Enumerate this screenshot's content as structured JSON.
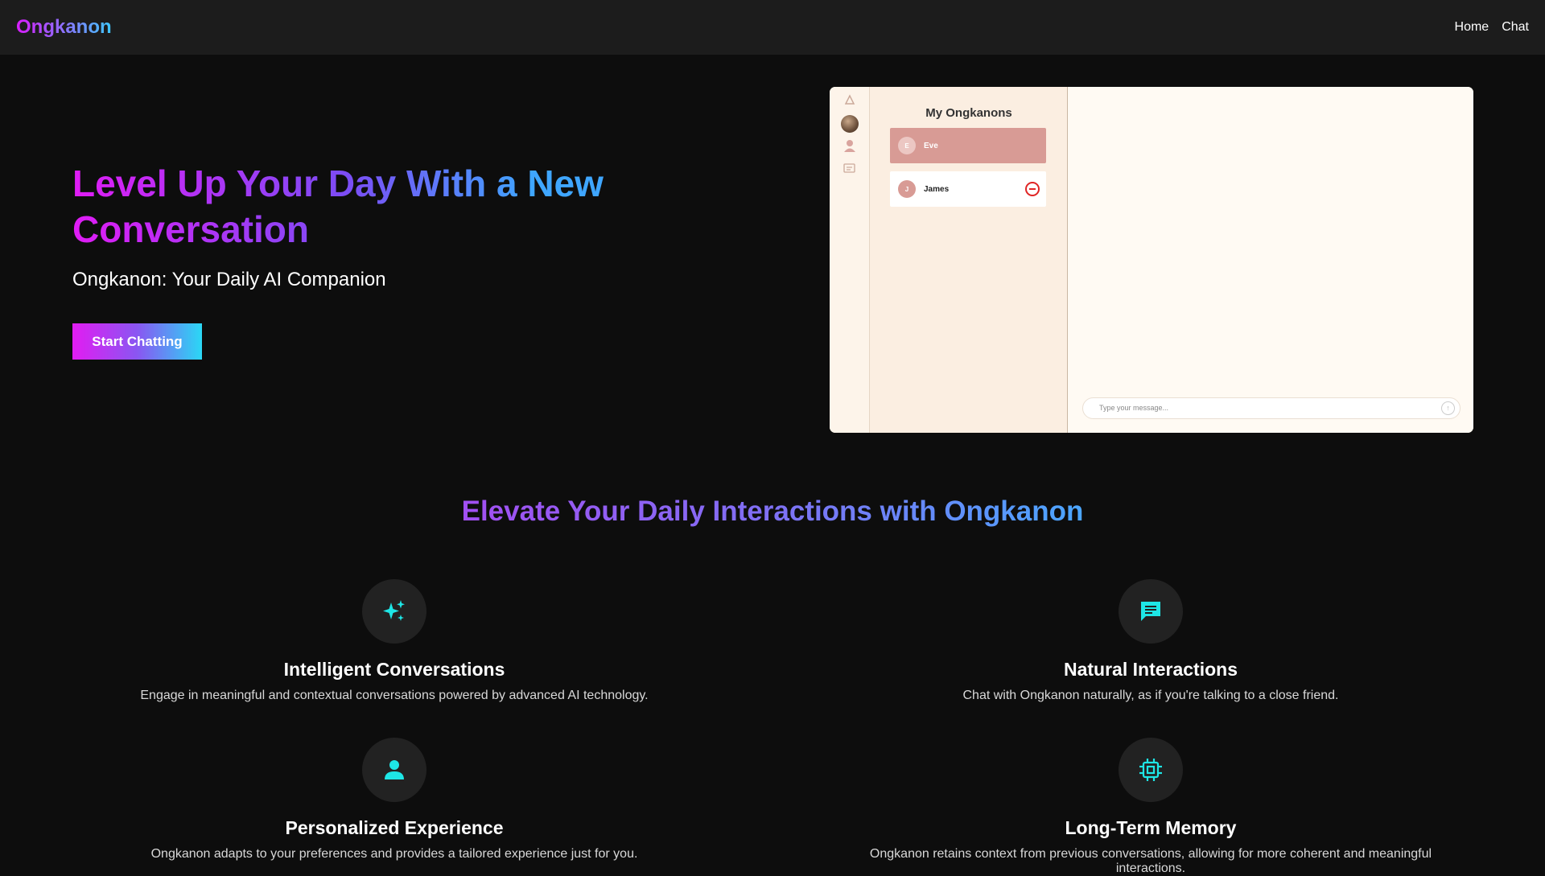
{
  "header": {
    "brand": "Ongkanon",
    "nav": [
      {
        "label": "Home"
      },
      {
        "label": "Chat"
      }
    ]
  },
  "hero": {
    "title_line1": "Level Up Your Day With a New",
    "title_line2": "Conversation",
    "subtitle": "Ongkanon: Your Daily AI Companion",
    "cta_label": "Start Chatting"
  },
  "preview": {
    "list_title": "My Ongkanons",
    "items": [
      {
        "initial": "E",
        "name": "Eve"
      },
      {
        "initial": "J",
        "name": "James"
      }
    ],
    "input_placeholder": "Type your message..."
  },
  "features": {
    "title": "Elevate Your Daily Interactions with Ongkanon",
    "items": [
      {
        "icon": "sparkles-icon",
        "title": "Intelligent Conversations",
        "desc": "Engage in meaningful and contextual conversations powered by advanced AI technology."
      },
      {
        "icon": "chat-bubble-icon",
        "title": "Natural Interactions",
        "desc": "Chat with Ongkanon naturally, as if you're talking to a close friend."
      },
      {
        "icon": "person-icon",
        "title": "Personalized Experience",
        "desc": "Ongkanon adapts to your preferences and provides a tailored experience just for you."
      },
      {
        "icon": "chip-icon",
        "title": "Long-Term Memory",
        "desc": "Ongkanon retains context from previous conversations, allowing for more coherent and meaningful interactions."
      }
    ]
  },
  "colors": {
    "accent_cyan": "#1ee6e6",
    "accent_magenta": "#e01cf5",
    "background": "#0d0d0d"
  }
}
